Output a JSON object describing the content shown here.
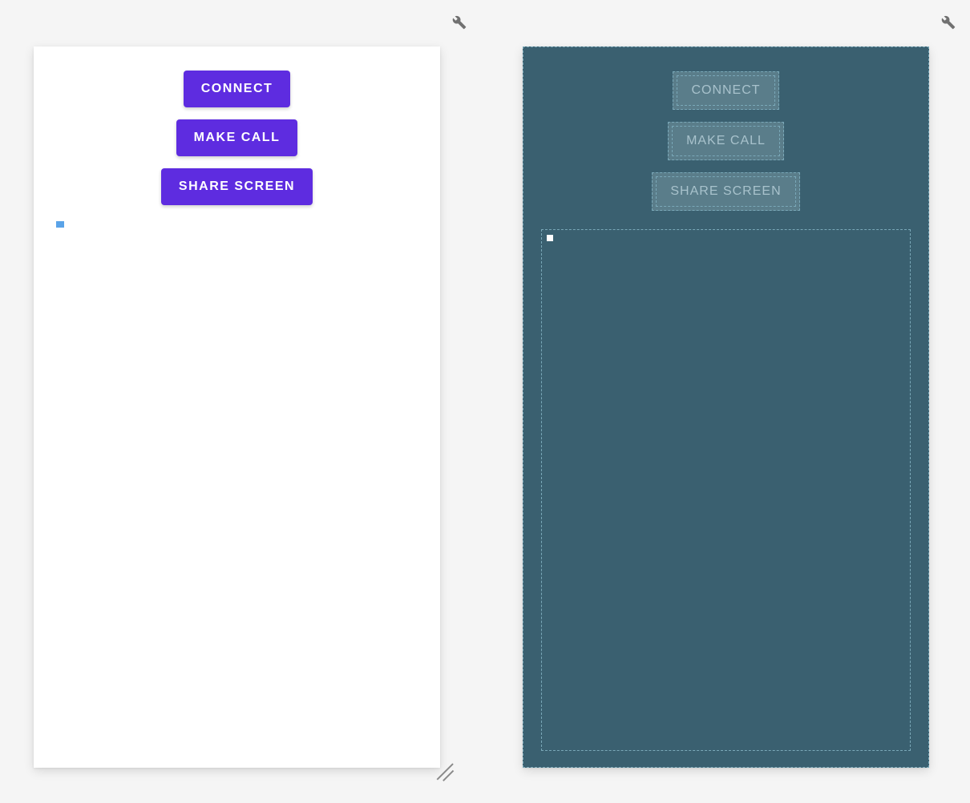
{
  "left_panel": {
    "buttons": {
      "connect": "CONNECT",
      "make_call": "MAKE CALL",
      "share_screen": "SHARE SCREEN"
    }
  },
  "right_panel": {
    "buttons": {
      "connect": "CONNECT",
      "make_call": "MAKE CALL",
      "share_screen": "SHARE SCREEN"
    }
  }
}
